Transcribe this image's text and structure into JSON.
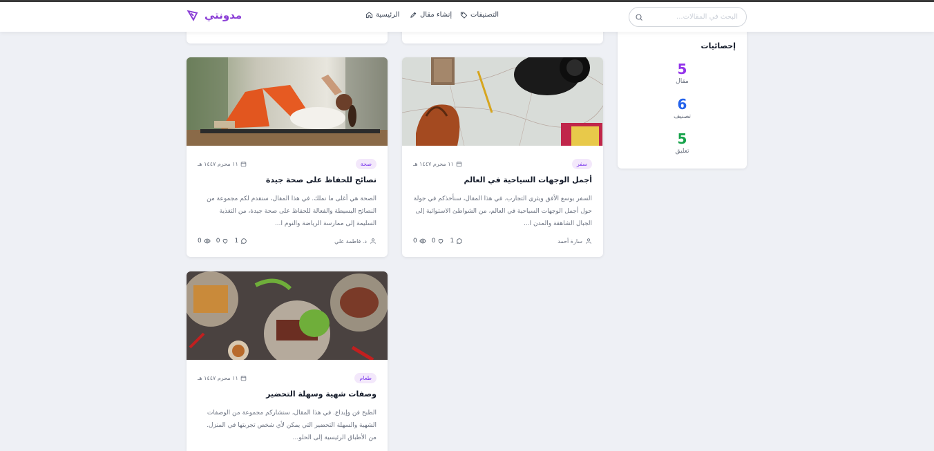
{
  "header": {
    "logo": "مدونتي",
    "search_placeholder": "البحث في المقالات...",
    "nav": [
      {
        "label": "الرئيسية",
        "icon": "home-icon"
      },
      {
        "label": "إنشاء مقال",
        "icon": "pen-icon"
      },
      {
        "label": "التصنيفات",
        "icon": "tag-icon"
      }
    ]
  },
  "sidebar": {
    "title": "إحصائيات",
    "stats": [
      {
        "value": "5",
        "label": "مقال",
        "color": "#9333ea"
      },
      {
        "value": "6",
        "label": "تصنيف",
        "color": "#2563eb"
      },
      {
        "value": "5",
        "label": "تعليق",
        "color": "#16a34a"
      }
    ]
  },
  "posts": [
    {
      "category": "صحة",
      "date": "١١ محرم ١٤٤٧ هـ",
      "title": "نصائح للحفاظ على صحة جيدة",
      "excerpt": "الصحة هي أغلى ما نملك. في هذا المقال، سنقدم لكم مجموعة من النصائح البسيطة والفعالة للحفاظ على صحة جيدة، من التغذية السليمة إلى ممارسة الرياضة والنوم ا...",
      "author": "د. فاطمة علي",
      "comments": "1",
      "likes": "0",
      "views": "0",
      "image": "fitness-photo"
    },
    {
      "category": "سفر",
      "date": "١١ محرم ١٤٤٧ هـ",
      "title": "أجمل الوجهات السياحية في العالم",
      "excerpt": "السفر يوسع الأفق ويثرى التجارب. في هذا المقال، سنأخذكم في جولة حول أجمل الوجهات السياحية في العالم، من الشواطئ الاستوائية إلى الجبال الشاهقة والمدن ا...",
      "author": "سارة أحمد",
      "comments": "1",
      "likes": "0",
      "views": "0",
      "image": "travel-map-photo"
    },
    {
      "category": "طعام",
      "date": "١١ محرم ١٤٤٧ هـ",
      "title": "وصفات شهية وسهلة التحضير",
      "excerpt": "الطبخ فن وإبداع. في هذا المقال، سنشاركم مجموعة من الوصفات الشهية والسهلة التحضير التي يمكن لأي شخص تجربتها في المنزل. من الأطباق الرئيسية إلى الحلو...",
      "author": "",
      "comments": "",
      "likes": "",
      "views": "",
      "image": "food-photo"
    }
  ]
}
